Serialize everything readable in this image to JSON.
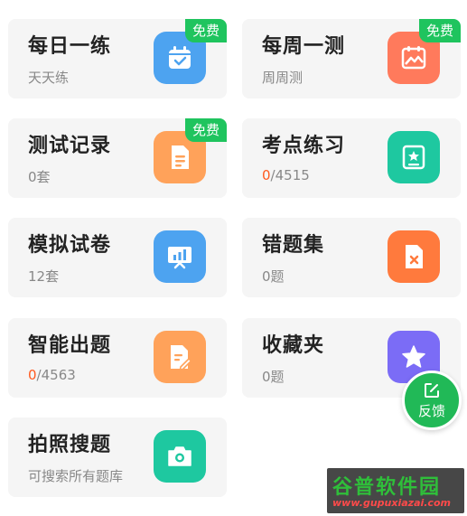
{
  "badge_free": "免费",
  "cards": [
    {
      "title": "每日一练",
      "sub": "天天练",
      "badge": true,
      "icon": "calendar-check-icon",
      "color": "#4da3f0"
    },
    {
      "title": "每周一测",
      "sub": "周周测",
      "badge": true,
      "icon": "image-chart-icon",
      "color": "#ff7a5c"
    },
    {
      "title": "测试记录",
      "sub": "0套",
      "badge": true,
      "icon": "document-icon",
      "color": "#ffa25a"
    },
    {
      "title": "考点练习",
      "sub_done": "0",
      "sub_total": "/4515",
      "badge": false,
      "icon": "star-book-icon",
      "color": "#1ec8a0"
    },
    {
      "title": "模拟试卷",
      "sub": "12套",
      "badge": false,
      "icon": "presentation-chart-icon",
      "color": "#4da3f0"
    },
    {
      "title": "错题集",
      "sub": "0题",
      "badge": false,
      "icon": "error-file-icon",
      "color": "#ff7a3d"
    },
    {
      "title": "智能出题",
      "sub_done": "0",
      "sub_total": "/4563",
      "badge": false,
      "icon": "document-edit-icon",
      "color": "#ffa25a"
    },
    {
      "title": "收藏夹",
      "sub": "0题",
      "badge": false,
      "icon": "star-icon",
      "color": "#7b6cf6"
    },
    {
      "title": "拍照搜题",
      "sub": "可搜索所有题库",
      "badge": false,
      "icon": "camera-icon",
      "color": "#1ec8a0"
    }
  ],
  "feedback": {
    "label": "反馈",
    "icon": "edit-icon",
    "color": "#21b957"
  },
  "watermark": {
    "logo": "谷普软件园",
    "url": "www.gupuxiazai.com"
  }
}
